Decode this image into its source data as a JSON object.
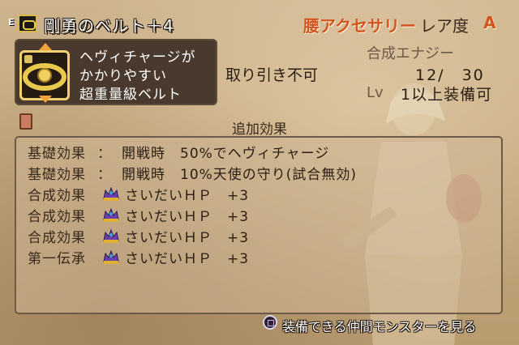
{
  "header": {
    "equip_badge": "E",
    "item_name": "剛勇のベルト＋4",
    "category": "腰アクセサリー",
    "rarity_label": "レア度",
    "rarity_value": "A"
  },
  "description": {
    "lines": [
      "ヘヴィチャージが",
      "かかりやすい",
      "超重量級ベルト"
    ]
  },
  "trade_status": "取り引き不可",
  "synthesis": {
    "label": "合成エナジー",
    "value": "12/　30"
  },
  "level": {
    "label": "Lv",
    "value": "1以上装備可"
  },
  "effects": {
    "heading": "追加効果",
    "rows": [
      {
        "kind": "基礎効果",
        "colon": "：",
        "text": "開戦時　50%でヘヴィチャージ",
        "icon": null
      },
      {
        "kind": "基礎効果",
        "colon": "：",
        "text": "開戦時　10%天使の守り(試合無効)",
        "icon": null
      },
      {
        "kind": "合成効果",
        "colon": "",
        "text": "さいだいＨＰ　+3",
        "icon": "crown-icon"
      },
      {
        "kind": "合成効果",
        "colon": "",
        "text": "さいだいＨＰ　+3",
        "icon": "crown-icon"
      },
      {
        "kind": "合成効果",
        "colon": "",
        "text": "さいだいＨＰ　+3",
        "icon": "crown-icon"
      },
      {
        "kind": "第一伝承",
        "colon": "",
        "text": "さいだいＨＰ　+3",
        "icon": "crown-icon"
      }
    ]
  },
  "footer": {
    "button_icon": "square-button-icon",
    "label": "装備できる仲間モンスターを見る"
  },
  "colors": {
    "accent_orange": "#d4541f",
    "parchment": "#c7ad85",
    "desc_box": "#4a3a2e",
    "arrow": "#f0a33a"
  }
}
